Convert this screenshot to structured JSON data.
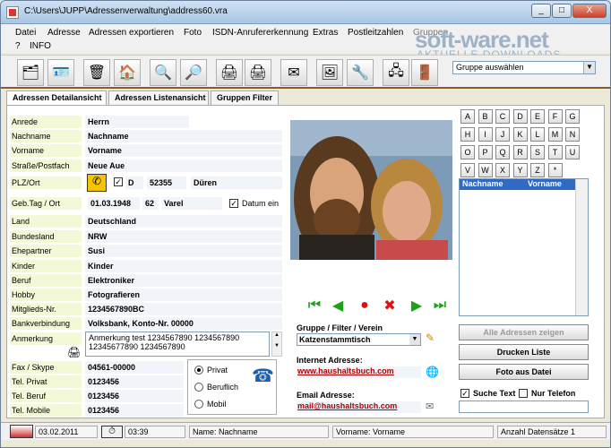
{
  "window": {
    "title": "C:\\Users\\JUPP\\Adressenverwaltung\\address60.vra",
    "min": "_",
    "max": "□",
    "close": "X"
  },
  "menu": [
    "Datei",
    "Adresse",
    "Adressen exportieren",
    "Foto",
    "ISDN-Anrufererkennung",
    "Extras",
    "Postleitzahlen",
    "Gruppen",
    "Liste",
    "Fenster",
    "?",
    "INFO"
  ],
  "watermark": {
    "brand": "soft-ware.net",
    "sub": "AKTUELLE DOWNLOADS"
  },
  "toolbar": {
    "group_select": "Gruppe auswählen"
  },
  "tabs": [
    "Adressen Detailansicht",
    "Adressen Listenansicht",
    "Gruppen Filter"
  ],
  "fields": {
    "anrede": {
      "label": "Anrede",
      "value": "Herrn"
    },
    "nachname": {
      "label": "Nachname",
      "value": "Nachname"
    },
    "vorname": {
      "label": "Vorname",
      "value": "Vorname"
    },
    "strasse": {
      "label": "Straße/Postfach",
      "value": "Neue Aue"
    },
    "plz": {
      "label": "PLZ/Ort",
      "country": "D",
      "plz": "52355",
      "ort": "Düren"
    },
    "geb": {
      "label": "Geb.Tag / Ort",
      "date": "01.03.1948",
      "age": "62",
      "ort": "Varel",
      "datum_ein": "Datum ein"
    },
    "land": {
      "label": "Land",
      "value": "Deutschland"
    },
    "bundesland": {
      "label": "Bundesland",
      "value": "NRW"
    },
    "ehepartner": {
      "label": "Ehepartner",
      "value": "Susi"
    },
    "kinder": {
      "label": "Kinder",
      "value": "Kinder"
    },
    "beruf": {
      "label": "Beruf",
      "value": "Elektroniker"
    },
    "hobby": {
      "label": "Hobby",
      "value": "Fotografieren"
    },
    "mitglieds": {
      "label": "Mitglieds-Nr.",
      "value": "1234567890BC"
    },
    "bank": {
      "label": "Bankverbindung",
      "value": "Volksbank, Konto-Nr. 00000"
    },
    "anmerkung": {
      "label": "Anmerkung",
      "value": "Anmerkung test 1234567890 1234567890 12345677890 1234567890"
    },
    "fax": {
      "label": "Fax / Skype",
      "value": "04561-00000"
    },
    "tel_privat": {
      "label": "Tel. Privat",
      "value": "0123456"
    },
    "tel_beruf": {
      "label": "Tel. Beruf",
      "value": "0123456"
    },
    "tel_mobile": {
      "label": "Tel. Mobile",
      "value": "0123456"
    }
  },
  "radios": [
    "Privat",
    "Beruflich",
    "Mobil"
  ],
  "group": {
    "label": "Gruppe  /  Filter / Verein",
    "value": "Katzenstammtisch"
  },
  "internet": {
    "label": "Internet Adresse:",
    "value": "www.haushaltsbuch.com"
  },
  "email": {
    "label": "Email Adresse:",
    "value": "mail@haushaltsbuch.com"
  },
  "alphabet": [
    "A",
    "B",
    "C",
    "D",
    "E",
    "F",
    "G",
    "H",
    "I",
    "J",
    "K",
    "L",
    "M",
    "N",
    "O",
    "P",
    "Q",
    "R",
    "S",
    "T",
    "U",
    "V",
    "W",
    "X",
    "Y",
    "Z",
    "*"
  ],
  "list": {
    "col1": "Nachname",
    "col2": "Vorname"
  },
  "buttons": {
    "alle": "Alle Adressen zeigen",
    "drucken": "Drucken Liste",
    "foto": "Foto aus Datei"
  },
  "search": {
    "suche": "Suche Text",
    "nur": "Nur Telefon"
  },
  "status": {
    "date": "03.02.2011",
    "time": "03:39",
    "name": "Name: Nachname",
    "vorname": "Vorname: Vorname",
    "count": "Anzahl Datensätze  1"
  }
}
